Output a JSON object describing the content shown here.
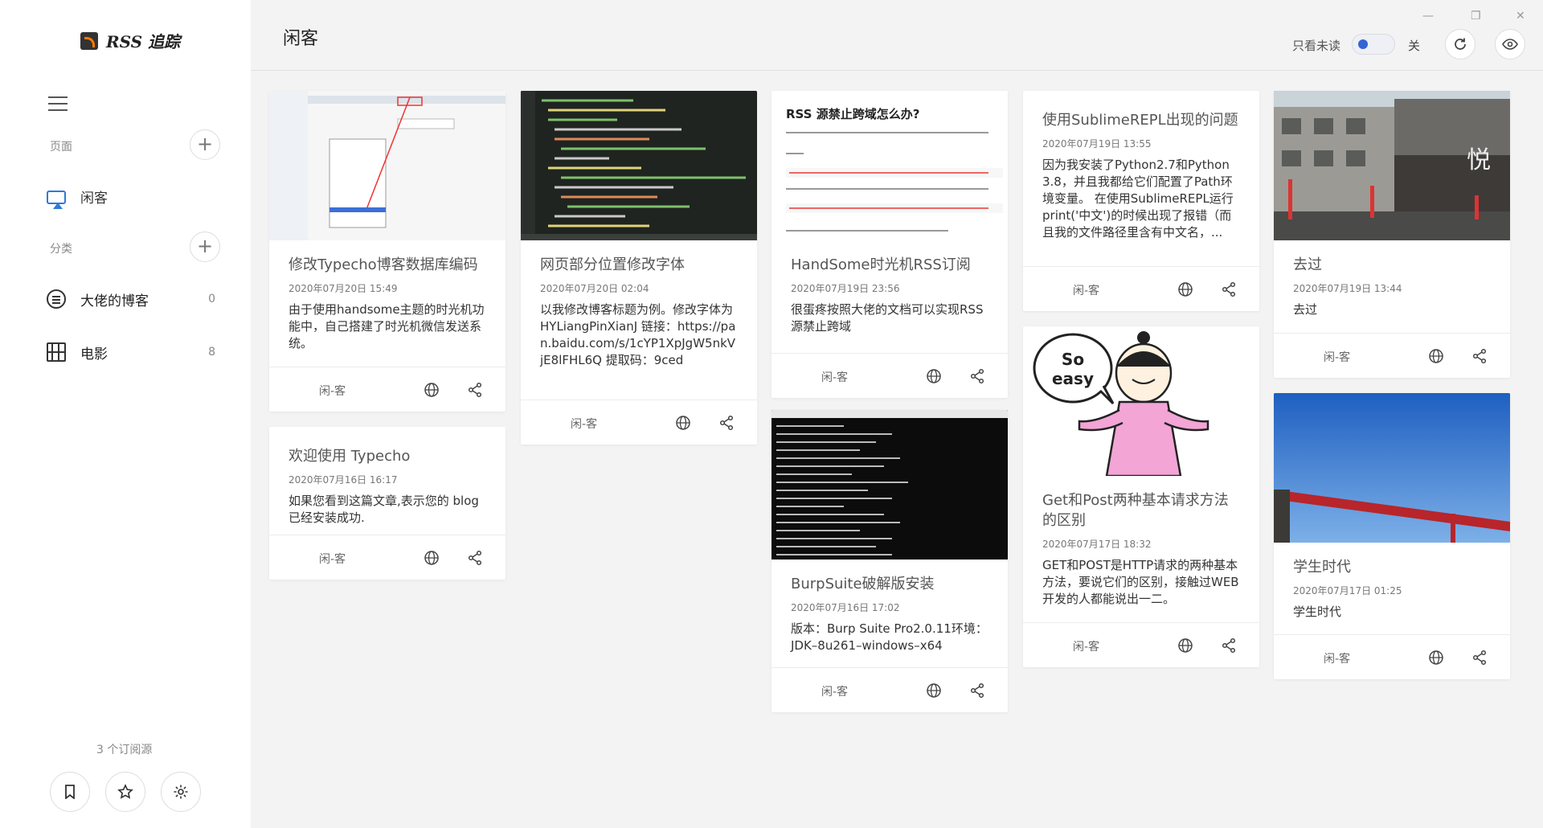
{
  "app": {
    "title": "RSS 追踪",
    "window_controls": {
      "minimize": "—",
      "restore": "❐",
      "close": "✕"
    }
  },
  "sidebar": {
    "pages_label": "页面",
    "categories_label": "分类",
    "pages": [
      {
        "label": "闲客",
        "icon": "tv-icon",
        "active": true
      }
    ],
    "categories": [
      {
        "label": "大佬的博客",
        "count": "0",
        "icon": "list-icon"
      },
      {
        "label": "电影",
        "count": "8",
        "icon": "film-icon"
      }
    ],
    "subscription_count": "3 个订阅源",
    "accent_color": "#2f7ad8"
  },
  "header": {
    "title": "闲客",
    "unread_only_label": "只看未读",
    "toggle_state": "关"
  },
  "cards": [
    {
      "title": "修改Typecho博客数据库编码",
      "date": "2020年07月20日 15:49",
      "snippet": "由于使用handsome主题的时光机功能中，自己搭建了时光机微信发送系统。",
      "source": "闲-客",
      "image": "phpmyadmin-screenshot"
    },
    {
      "title": "欢迎使用 Typecho",
      "date": "2020年07月16日 16:17",
      "snippet": "如果您看到这篇文章,表示您的 blog 已经安装成功.",
      "source": "闲-客",
      "image": ""
    },
    {
      "title": "网页部分位置修改字体",
      "date": "2020年07月20日 02:04",
      "snippet": "以我修改博客标题为例。修改字体为HYLiangPinXianJ 链接：https://pan.baidu.com/s/1cYP1XpJgW5nkVjE8lFHL6Q 提取码：9ced",
      "source": "闲-客",
      "image": "code-editor-screenshot"
    },
    {
      "title": "HandSome时光机RSS订阅",
      "date": "2020年07月19日 23:56",
      "snippet": "很蛋疼按照大佬的文档可以实现RSS源禁止跨域",
      "source": "闲-客",
      "image": "rss-doc-screenshot",
      "image_heading": "RSS 源禁止跨域怎么办?"
    },
    {
      "title": "BurpSuite破解版安装",
      "date": "2020年07月16日 17:02",
      "snippet": "版本：Burp Suite Pro2.0.11环境：JDK–8u261–windows–x64",
      "source": "闲-客",
      "image": "cmd-screenshot"
    },
    {
      "title": "使用SublimeREPL出现的问题",
      "date": "2020年07月19日 13:55",
      "snippet": "因为我安装了Python2.7和Python3.8，并且我都给它们配置了Path环境变量。 在使用SublimeREPL运行print('中文')的时候出现了报错（而且我的文件路径里含有中文名，...",
      "source": "闲-客",
      "image": ""
    },
    {
      "title": "Get和Post两种基本请求方法的区别",
      "date": "2020年07月17日 18:32",
      "snippet": "GET和POST是HTTP请求的两种基本方法，要说它们的区别，接触过WEB开发的人都能说出一二。",
      "source": "闲-客",
      "image": "cartoon-so-easy",
      "image_text": "So easy"
    },
    {
      "title": "去过",
      "date": "2020年07月19日 13:44",
      "snippet": "去过",
      "source": "闲-客",
      "image": "street-photo"
    },
    {
      "title": "学生时代",
      "date": "2020年07月17日 01:25",
      "snippet": "学生时代",
      "source": "闲-客",
      "image": "sky-photo"
    }
  ]
}
